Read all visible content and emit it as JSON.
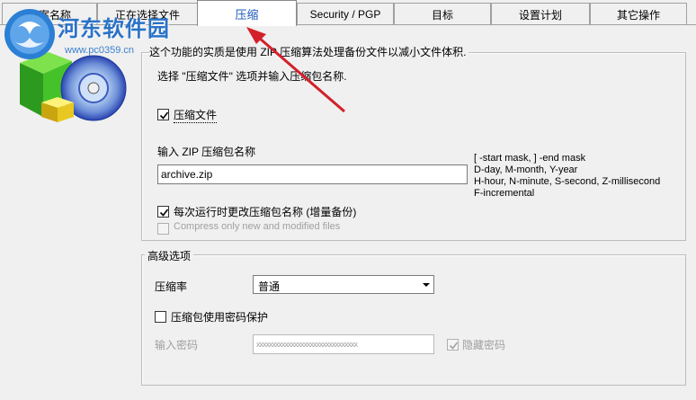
{
  "watermark": {
    "title": "河东软件园",
    "url": "www.pc0359.cn"
  },
  "tabs": [
    {
      "label": "方案名称",
      "active": false
    },
    {
      "label": "正在选择文件",
      "active": false
    },
    {
      "label": "压缩",
      "active": true
    },
    {
      "label": "Security / PGP",
      "active": false
    },
    {
      "label": "目标",
      "active": false
    },
    {
      "label": "设置计划",
      "active": false
    },
    {
      "label": "其它操作",
      "active": false
    }
  ],
  "compress": {
    "description": "这个功能的实质是使用 ZIP 压缩算法处理备份文件以减小文件体积.",
    "instruction": "选择 \"压缩文件\" 选项并输入压缩包名称.",
    "compress_files": {
      "label": "压缩文件",
      "checked": true
    },
    "zip_name_label": "输入 ZIP 压缩包名称",
    "zip_name_value": "archive.zip",
    "mask_hints": [
      "[ -start mask, ] -end mask",
      "D-day, M-month, Y-year",
      "H-hour, N-minute, S-second,  Z-millisecond",
      "F-incremental"
    ],
    "change_name_each_run": {
      "label": "每次运行时更改压缩包名称 (增量备份)",
      "checked": true
    },
    "compress_only_new": {
      "label": "Compress only new and modified files",
      "checked": false,
      "enabled": false
    }
  },
  "advanced": {
    "title": "高级选项",
    "ratio_label": "压缩率",
    "ratio_value": "普通",
    "password_protect": {
      "label": "压缩包使用密码保护",
      "checked": false
    },
    "password_label": "输入密码",
    "password_value": "xxxxxxxxxxxxxxxxxxxxxxxxxxxxxxxx",
    "hide_password": {
      "label": "隐藏密码",
      "checked": true,
      "enabled": false
    }
  },
  "colors": {
    "active_tab_text": "#1a58b8",
    "arrow": "#d4202a",
    "watermark": "#2a72c8"
  }
}
